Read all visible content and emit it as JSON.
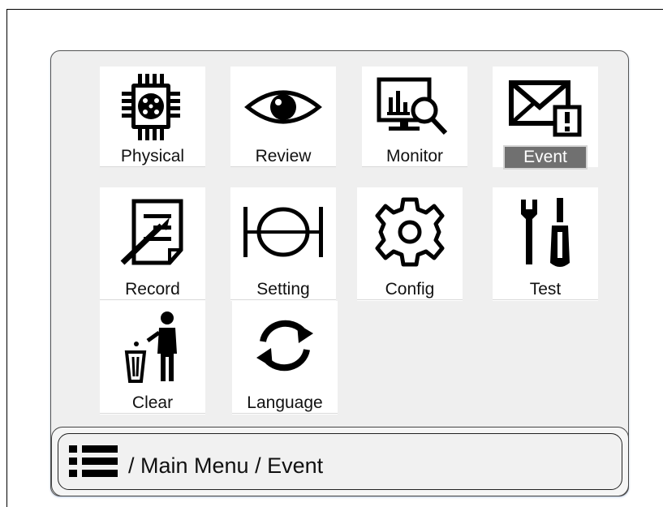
{
  "menu": {
    "items": [
      {
        "label": "Physical",
        "icon": "chip-icon"
      },
      {
        "label": "Review",
        "icon": "eye-icon"
      },
      {
        "label": "Monitor",
        "icon": "monitor-search-icon"
      },
      {
        "label": "Event",
        "icon": "mail-alert-icon",
        "selected": true
      },
      {
        "label": "Record",
        "icon": "document-pen-icon"
      },
      {
        "label": "Setting",
        "icon": "theta-bracket-icon"
      },
      {
        "label": "Config",
        "icon": "gear-icon"
      },
      {
        "label": "Test",
        "icon": "wrench-screwdriver-icon"
      },
      {
        "label": "Clear",
        "icon": "trash-person-icon"
      },
      {
        "label": "Language",
        "icon": "refresh-arrows-icon"
      }
    ]
  },
  "breadcrumb": {
    "icon": "list-menu-icon",
    "path": "/ Main Menu / Event"
  },
  "colors": {
    "selected_bg": "#707070",
    "panel_bg": "#efefef"
  }
}
